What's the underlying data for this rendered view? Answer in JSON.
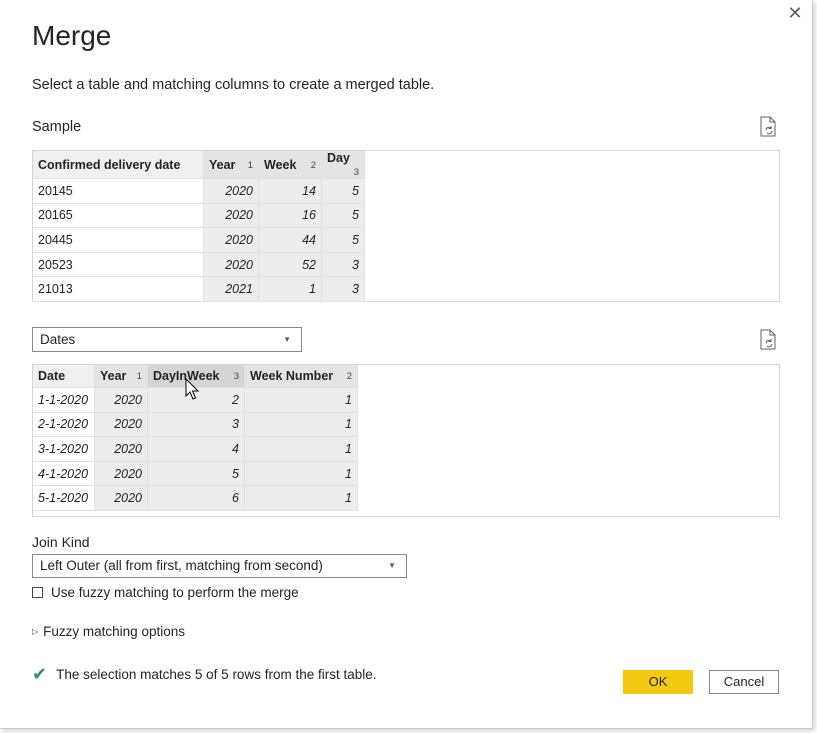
{
  "dialog": {
    "title": "Merge",
    "subtitle": "Select a table and matching columns to create a merged table.",
    "close_glyph": "✕"
  },
  "sample": {
    "label": "Sample",
    "columns": [
      {
        "name": "Confirmed delivery date",
        "order": ""
      },
      {
        "name": "Year",
        "order": "1"
      },
      {
        "name": "Week",
        "order": "2"
      },
      {
        "name": "Day",
        "order": "3"
      }
    ],
    "rows": [
      [
        "20145",
        "2020",
        "14",
        "5"
      ],
      [
        "20165",
        "2020",
        "16",
        "5"
      ],
      [
        "20445",
        "2020",
        "44",
        "5"
      ],
      [
        "20523",
        "2020",
        "52",
        "3"
      ],
      [
        "21013",
        "2021",
        "1",
        "3"
      ]
    ]
  },
  "second_table": {
    "selected": "Dates",
    "columns": [
      {
        "name": "Date",
        "order": ""
      },
      {
        "name": "Year",
        "order": "1"
      },
      {
        "name": "DayInWeek",
        "order": "3"
      },
      {
        "name": "Week Number",
        "order": "2"
      }
    ],
    "rows": [
      [
        "1-1-2020",
        "2020",
        "2",
        "1"
      ],
      [
        "2-1-2020",
        "2020",
        "3",
        "1"
      ],
      [
        "3-1-2020",
        "2020",
        "4",
        "1"
      ],
      [
        "4-1-2020",
        "2020",
        "5",
        "1"
      ],
      [
        "5-1-2020",
        "2020",
        "6",
        "1"
      ]
    ]
  },
  "join": {
    "label": "Join Kind",
    "selected": "Left Outer (all from first, matching from second)"
  },
  "fuzzy": {
    "checkbox_label": "Use fuzzy matching to perform the merge",
    "checked": false,
    "options_label": "Fuzzy matching options"
  },
  "status": {
    "text": "The selection matches 5 of 5 rows from the first table."
  },
  "buttons": {
    "ok": "OK",
    "cancel": "Cancel"
  },
  "colors": {
    "ok_button": "#f2c811",
    "check": "#3a8a6a"
  },
  "icons": [
    "close-icon",
    "refresh-icon",
    "chevron-down-icon",
    "checkmark-icon",
    "expand-triangle-icon",
    "mouse-cursor-icon"
  ]
}
